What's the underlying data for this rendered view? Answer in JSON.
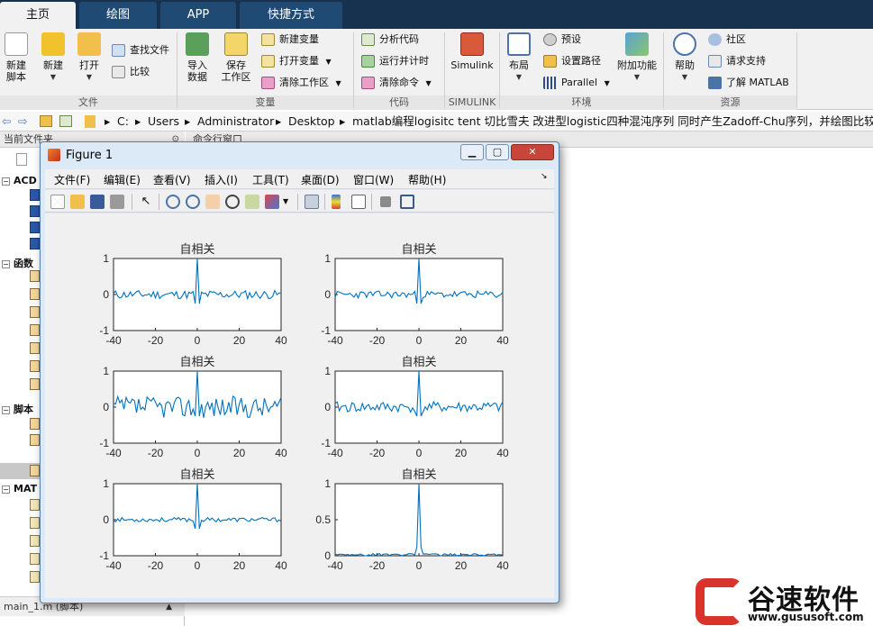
{
  "tabs": [
    {
      "label": "主页",
      "active": true
    },
    {
      "label": "绘图",
      "active": false
    },
    {
      "label": "APP",
      "active": false
    },
    {
      "label": "快捷方式",
      "active": false
    }
  ],
  "ribbon": {
    "file": {
      "section": "文件",
      "new_script": "新建\n脚本",
      "new": "新建",
      "open": "打开",
      "find_files": "查找文件",
      "compare": "比较"
    },
    "variable": {
      "section": "变量",
      "import": "导入\n数据",
      "save_ws": "保存\n工作区",
      "new_var": "新建变量",
      "open_var": "打开变量",
      "clear_ws": "清除工作区"
    },
    "code": {
      "section": "代码",
      "analyze": "分析代码",
      "run_time": "运行并计时",
      "clear_cmd": "清除命令"
    },
    "simulink": {
      "section": "SIMULINK",
      "simulink": "Simulink"
    },
    "env": {
      "section": "环境",
      "layout": "布局",
      "prefs": "预设",
      "set_path": "设置路径",
      "parallel": "Parallel",
      "addons": "附加功能"
    },
    "resources": {
      "section": "资源",
      "help": "帮助",
      "community": "社区",
      "support": "请求支持",
      "learn": "了解 MATLAB"
    }
  },
  "address": {
    "segments": [
      "C:",
      "Users",
      "Administrator",
      "Desktop",
      "matlab编程logisitc tent 切比雪夫 改进型logistic四种混沌序列 同时产生Zadoff-Chu序列，并绘图比较几种序"
    ]
  },
  "panels": {
    "current_folder": "当前文件夹",
    "command_window": "命令行窗口"
  },
  "tree": {
    "g1": "ACD",
    "g2": "函数",
    "g3": "脚本",
    "g4": "MAT"
  },
  "status": {
    "file": "main_1.m  (脚本)"
  },
  "figure": {
    "title": "Figure 1",
    "menus": [
      "文件(F)",
      "编辑(E)",
      "查看(V)",
      "插入(I)",
      "工具(T)",
      "桌面(D)",
      "窗口(W)",
      "帮助(H)"
    ]
  },
  "chart_data": [
    {
      "type": "line",
      "title": "自相关",
      "xlim": [
        -40,
        40
      ],
      "ylim": [
        -1,
        1
      ],
      "xticks": [
        -40,
        -20,
        0,
        20,
        40
      ],
      "yticks": [
        -1,
        0,
        1
      ],
      "color": "#0072bd",
      "peak": 1,
      "noise": 0.12,
      "seed": 11
    },
    {
      "type": "line",
      "title": "自相关",
      "xlim": [
        -40,
        40
      ],
      "ylim": [
        -1,
        1
      ],
      "xticks": [
        -40,
        -20,
        0,
        20,
        40
      ],
      "yticks": [
        -1,
        0,
        1
      ],
      "color": "#0072bd",
      "peak": 1,
      "noise": 0.1,
      "seed": 23
    },
    {
      "type": "line",
      "title": "自相关",
      "xlim": [
        -40,
        40
      ],
      "ylim": [
        -1,
        1
      ],
      "xticks": [
        -40,
        -20,
        0,
        20,
        40
      ],
      "yticks": [
        -1,
        0,
        1
      ],
      "color": "#0072bd",
      "peak": 1,
      "noise": 0.3,
      "seed": 37
    },
    {
      "type": "line",
      "title": "自相关",
      "xlim": [
        -40,
        40
      ],
      "ylim": [
        -1,
        1
      ],
      "xticks": [
        -40,
        -20,
        0,
        20,
        40
      ],
      "yticks": [
        -1,
        0,
        1
      ],
      "color": "#0072bd",
      "peak": 1,
      "noise": 0.15,
      "seed": 41
    },
    {
      "type": "line",
      "title": "自相关",
      "xlim": [
        -40,
        40
      ],
      "ylim": [
        -1,
        1
      ],
      "xticks": [
        -40,
        -20,
        0,
        20,
        40
      ],
      "yticks": [
        -1,
        0,
        1
      ],
      "color": "#0072bd",
      "peak": 1,
      "noise": 0.06,
      "seed": 53
    },
    {
      "type": "line",
      "title": "自相关",
      "xlim": [
        -40,
        40
      ],
      "ylim": [
        0,
        1
      ],
      "xticks": [
        -40,
        -20,
        0,
        20,
        40
      ],
      "yticks": [
        0,
        0.5,
        1
      ],
      "color": "#0072bd",
      "peak": 1,
      "noise": 0.03,
      "seed": 67,
      "nonneg": true
    }
  ],
  "watermark": {
    "brand": "谷速软件",
    "url": "www.gususoft.com",
    "color": "#d9342b"
  }
}
